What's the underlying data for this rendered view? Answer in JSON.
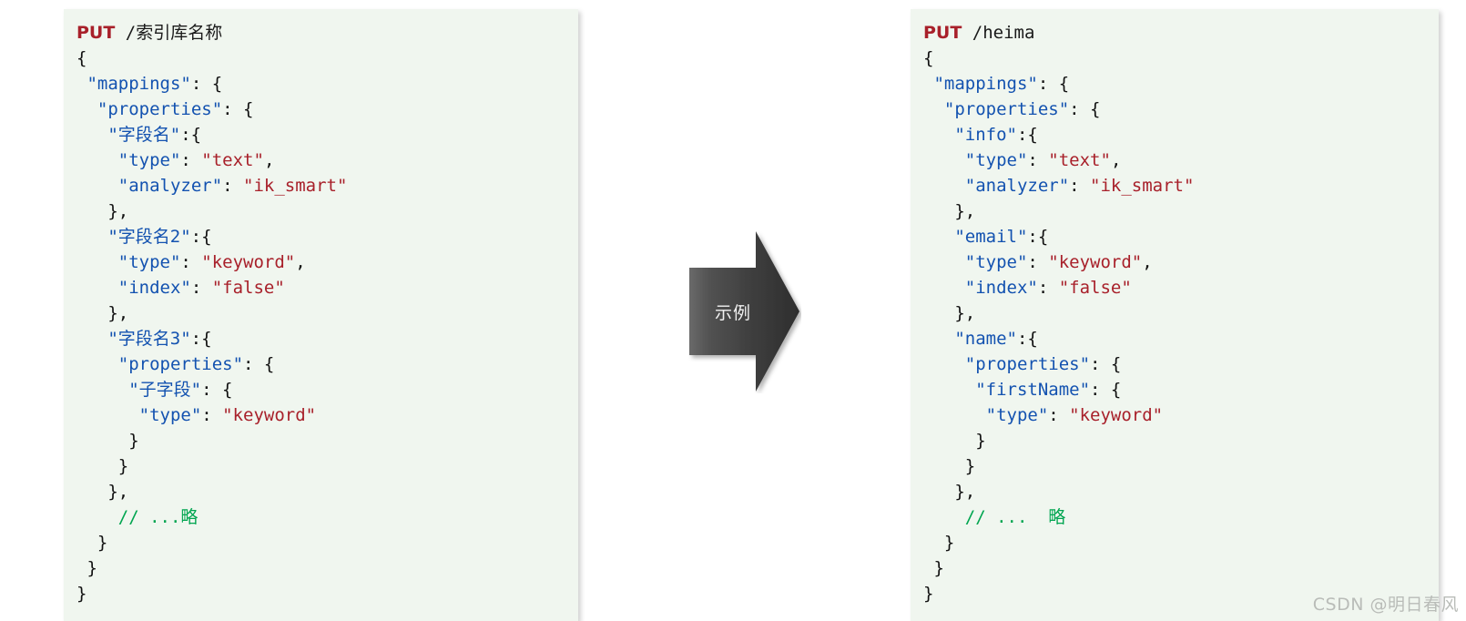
{
  "colors": {
    "panel_background": "#f0f6ef",
    "key_blue": "#1352b0",
    "string_red": "#a8202a",
    "comment_green": "#00a550",
    "punctuation": "#111111",
    "arrow_dark": "#3d3d3d",
    "watermark_gray": "#b9bcb8"
  },
  "left_panel": {
    "name": "template-mapping-request",
    "method": "PUT",
    "path": "/索引库名称",
    "lines": [
      [
        {
          "t": "punct",
          "v": "{"
        }
      ],
      [
        {
          "t": "punct",
          "v": " "
        },
        {
          "t": "key",
          "v": "\"mappings\""
        },
        {
          "t": "punct",
          "v": ": {"
        }
      ],
      [
        {
          "t": "punct",
          "v": "  "
        },
        {
          "t": "key",
          "v": "\"properties\""
        },
        {
          "t": "punct",
          "v": ": {"
        }
      ],
      [
        {
          "t": "punct",
          "v": "   "
        },
        {
          "t": "cjk",
          "v": "\"字段名\""
        },
        {
          "t": "punct",
          "v": ":{"
        }
      ],
      [
        {
          "t": "punct",
          "v": "    "
        },
        {
          "t": "key",
          "v": "\"type\""
        },
        {
          "t": "punct",
          "v": ": "
        },
        {
          "t": "str",
          "v": "\"text\""
        },
        {
          "t": "punct",
          "v": ","
        }
      ],
      [
        {
          "t": "punct",
          "v": "    "
        },
        {
          "t": "key",
          "v": "\"analyzer\""
        },
        {
          "t": "punct",
          "v": ": "
        },
        {
          "t": "str",
          "v": "\"ik_smart\""
        }
      ],
      [
        {
          "t": "punct",
          "v": "   },"
        }
      ],
      [
        {
          "t": "punct",
          "v": "   "
        },
        {
          "t": "cjk",
          "v": "\"字段名2\""
        },
        {
          "t": "punct",
          "v": ":{"
        }
      ],
      [
        {
          "t": "punct",
          "v": "    "
        },
        {
          "t": "key",
          "v": "\"type\""
        },
        {
          "t": "punct",
          "v": ": "
        },
        {
          "t": "str",
          "v": "\"keyword\""
        },
        {
          "t": "punct",
          "v": ","
        }
      ],
      [
        {
          "t": "punct",
          "v": "    "
        },
        {
          "t": "key",
          "v": "\"index\""
        },
        {
          "t": "punct",
          "v": ": "
        },
        {
          "t": "str",
          "v": "\"false\""
        }
      ],
      [
        {
          "t": "punct",
          "v": "   },"
        }
      ],
      [
        {
          "t": "punct",
          "v": "   "
        },
        {
          "t": "cjk",
          "v": "\"字段名3\""
        },
        {
          "t": "punct",
          "v": ":{"
        }
      ],
      [
        {
          "t": "punct",
          "v": "    "
        },
        {
          "t": "key",
          "v": "\"properties\""
        },
        {
          "t": "punct",
          "v": ": {"
        }
      ],
      [
        {
          "t": "punct",
          "v": "     "
        },
        {
          "t": "cjk",
          "v": "\"子字段\""
        },
        {
          "t": "punct",
          "v": ": {"
        }
      ],
      [
        {
          "t": "punct",
          "v": "      "
        },
        {
          "t": "key",
          "v": "\"type\""
        },
        {
          "t": "punct",
          "v": ": "
        },
        {
          "t": "str",
          "v": "\"keyword\""
        }
      ],
      [
        {
          "t": "punct",
          "v": "     }"
        }
      ],
      [
        {
          "t": "punct",
          "v": "    }"
        }
      ],
      [
        {
          "t": "punct",
          "v": "   },"
        }
      ],
      [
        {
          "t": "punct",
          "v": "    "
        },
        {
          "t": "comment",
          "v": "// ...略"
        }
      ],
      [
        {
          "t": "punct",
          "v": "  }"
        }
      ],
      [
        {
          "t": "punct",
          "v": " }"
        }
      ],
      [
        {
          "t": "punct",
          "v": "}"
        }
      ]
    ]
  },
  "right_panel": {
    "name": "example-mapping-request",
    "method": "PUT",
    "path": "/heima",
    "lines": [
      [
        {
          "t": "punct",
          "v": "{"
        }
      ],
      [
        {
          "t": "punct",
          "v": " "
        },
        {
          "t": "key",
          "v": "\"mappings\""
        },
        {
          "t": "punct",
          "v": ": {"
        }
      ],
      [
        {
          "t": "punct",
          "v": "  "
        },
        {
          "t": "key",
          "v": "\"properties\""
        },
        {
          "t": "punct",
          "v": ": {"
        }
      ],
      [
        {
          "t": "punct",
          "v": "   "
        },
        {
          "t": "key",
          "v": "\"info\""
        },
        {
          "t": "punct",
          "v": ":{"
        }
      ],
      [
        {
          "t": "punct",
          "v": "    "
        },
        {
          "t": "key",
          "v": "\"type\""
        },
        {
          "t": "punct",
          "v": ": "
        },
        {
          "t": "str",
          "v": "\"text\""
        },
        {
          "t": "punct",
          "v": ","
        }
      ],
      [
        {
          "t": "punct",
          "v": "    "
        },
        {
          "t": "key",
          "v": "\"analyzer\""
        },
        {
          "t": "punct",
          "v": ": "
        },
        {
          "t": "str",
          "v": "\"ik_smart\""
        }
      ],
      [
        {
          "t": "punct",
          "v": "   },"
        }
      ],
      [
        {
          "t": "punct",
          "v": "   "
        },
        {
          "t": "key",
          "v": "\"email\""
        },
        {
          "t": "punct",
          "v": ":{"
        }
      ],
      [
        {
          "t": "punct",
          "v": "    "
        },
        {
          "t": "key",
          "v": "\"type\""
        },
        {
          "t": "punct",
          "v": ": "
        },
        {
          "t": "str",
          "v": "\"keyword\""
        },
        {
          "t": "punct",
          "v": ","
        }
      ],
      [
        {
          "t": "punct",
          "v": "    "
        },
        {
          "t": "key",
          "v": "\"index\""
        },
        {
          "t": "punct",
          "v": ": "
        },
        {
          "t": "str",
          "v": "\"false\""
        }
      ],
      [
        {
          "t": "punct",
          "v": "   },"
        }
      ],
      [
        {
          "t": "punct",
          "v": "   "
        },
        {
          "t": "key",
          "v": "\"name\""
        },
        {
          "t": "punct",
          "v": ":{"
        }
      ],
      [
        {
          "t": "punct",
          "v": "    "
        },
        {
          "t": "key",
          "v": "\"properties\""
        },
        {
          "t": "punct",
          "v": ": {"
        }
      ],
      [
        {
          "t": "punct",
          "v": "     "
        },
        {
          "t": "key",
          "v": "\"firstName\""
        },
        {
          "t": "punct",
          "v": ": {"
        }
      ],
      [
        {
          "t": "punct",
          "v": "      "
        },
        {
          "t": "key",
          "v": "\"type\""
        },
        {
          "t": "punct",
          "v": ": "
        },
        {
          "t": "str",
          "v": "\"keyword\""
        }
      ],
      [
        {
          "t": "punct",
          "v": "     }"
        }
      ],
      [
        {
          "t": "punct",
          "v": "    }"
        }
      ],
      [
        {
          "t": "punct",
          "v": "   },"
        }
      ],
      [
        {
          "t": "punct",
          "v": "    "
        },
        {
          "t": "comment",
          "v": "// ...  略"
        }
      ],
      [
        {
          "t": "punct",
          "v": "  }"
        }
      ],
      [
        {
          "t": "punct",
          "v": " }"
        }
      ],
      [
        {
          "t": "punct",
          "v": "}"
        }
      ]
    ]
  },
  "arrow": {
    "label": "示例"
  },
  "watermark": {
    "text": "CSDN @明日春风"
  }
}
